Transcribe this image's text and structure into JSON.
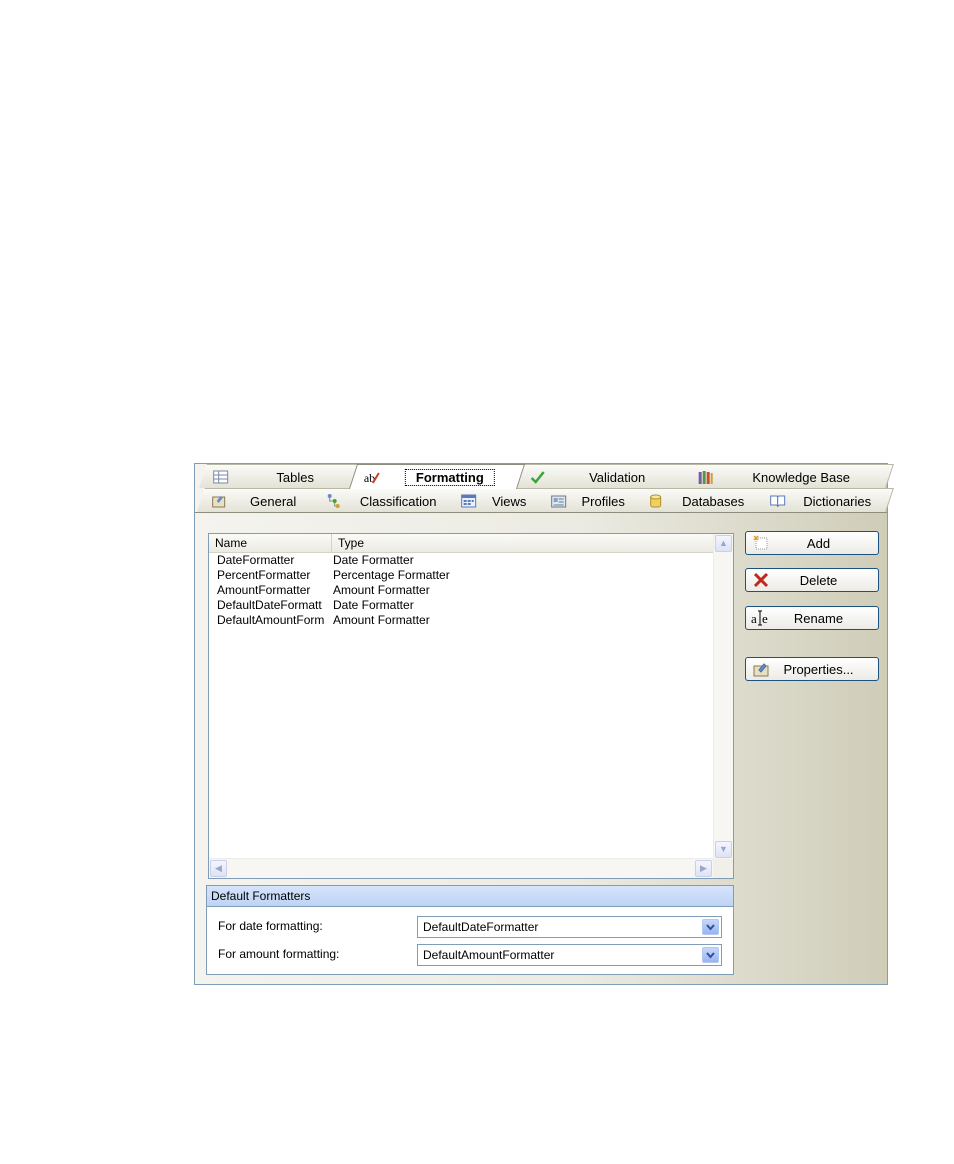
{
  "tabs": {
    "row1": [
      {
        "label": "Tables",
        "icon": "table-icon"
      },
      {
        "label": "Formatting",
        "icon": "formatting-icon",
        "active": true
      },
      {
        "label": "Validation",
        "icon": "checkmark-icon"
      },
      {
        "label": "Knowledge Base",
        "icon": "books-icon"
      }
    ],
    "row2": [
      {
        "label": "General",
        "icon": "general-icon"
      },
      {
        "label": "Classification",
        "icon": "classification-icon"
      },
      {
        "label": "Views",
        "icon": "views-icon"
      },
      {
        "label": "Profiles",
        "icon": "profiles-icon"
      },
      {
        "label": "Databases",
        "icon": "database-icon"
      },
      {
        "label": "Dictionaries",
        "icon": "dictionary-icon"
      }
    ]
  },
  "list": {
    "columns": [
      "Name",
      "Type"
    ],
    "rows": [
      {
        "name": "DateFormatter",
        "type": "Date Formatter"
      },
      {
        "name": "PercentFormatter",
        "type": "Percentage Formatter"
      },
      {
        "name": "AmountFormatter",
        "type": "Amount Formatter"
      },
      {
        "name": "DefaultDateFormatt",
        "type": "Date Formatter"
      },
      {
        "name": "DefaultAmountForm",
        "type": "Amount Formatter"
      }
    ]
  },
  "buttons": {
    "add": "Add",
    "delete": "Delete",
    "rename": "Rename",
    "properties": "Properties..."
  },
  "default_formatters": {
    "title": "Default Formatters",
    "date_label": "For date formatting:",
    "date_value": "DefaultDateFormatter",
    "amount_label": "For amount formatting:",
    "amount_value": "DefaultAmountFormatter"
  },
  "colors": {
    "accent_blue": "#7f9db9",
    "delete_red": "#c0281e",
    "check_green": "#3aa53a"
  }
}
